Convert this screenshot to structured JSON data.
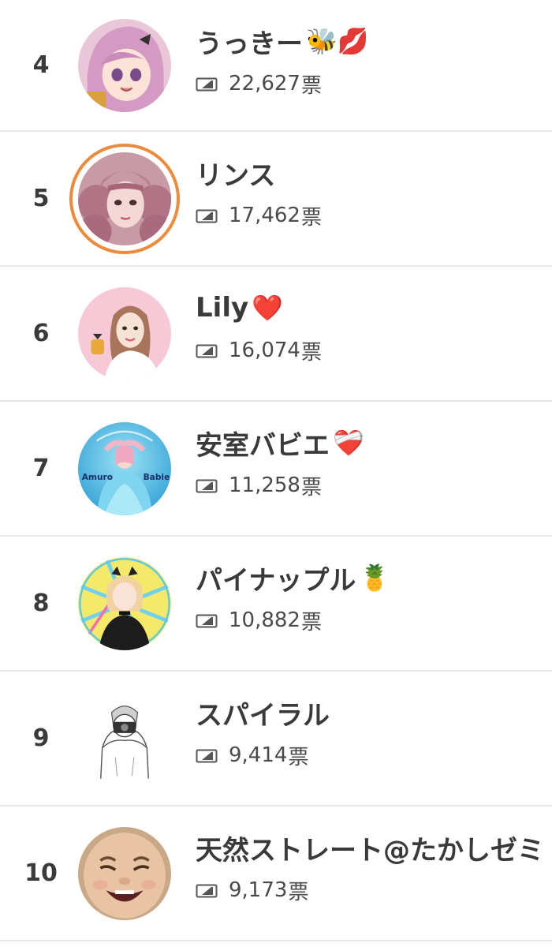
{
  "ranking": [
    {
      "rank": "4",
      "name": "うっきー",
      "emoji": "🐝💋",
      "count": "22,627",
      "unit": "票",
      "avatar": "anime-pink-hair-avatar",
      "highlight": false
    },
    {
      "rank": "5",
      "name": "リンス",
      "emoji": "",
      "count": "17,462",
      "unit": "票",
      "avatar": "pink-curly-hair-avatar",
      "highlight": true,
      "ring_color": "#ef8a3a"
    },
    {
      "rank": "6",
      "name": "Lily",
      "emoji": "❤️",
      "count": "16,074",
      "unit": "票",
      "avatar": "woman-pink-background-avatar",
      "highlight": false
    },
    {
      "rank": "7",
      "name": "安室バビエ",
      "emoji": "❤️‍🩹",
      "count": "11,258",
      "unit": "票",
      "avatar": "blue-dress-avatar",
      "highlight": false,
      "avatar_text_left": "Amuro",
      "avatar_text_right": "Babie"
    },
    {
      "rank": "8",
      "name": "パイナップル",
      "emoji": "🍍",
      "count": "10,882",
      "unit": "票",
      "avatar": "blonde-woman-yellow-background-avatar",
      "highlight": false
    },
    {
      "rank": "9",
      "name": "スパイラル",
      "emoji": "",
      "count": "9,414",
      "unit": "票",
      "avatar": "sketch-man-with-camera-avatar",
      "highlight": false
    },
    {
      "rank": "10",
      "name": "天然ストレート@たかしゼミ",
      "emoji": "",
      "count": "9,173",
      "unit": "票",
      "avatar": "laughing-baby-face-avatar",
      "highlight": false
    }
  ]
}
